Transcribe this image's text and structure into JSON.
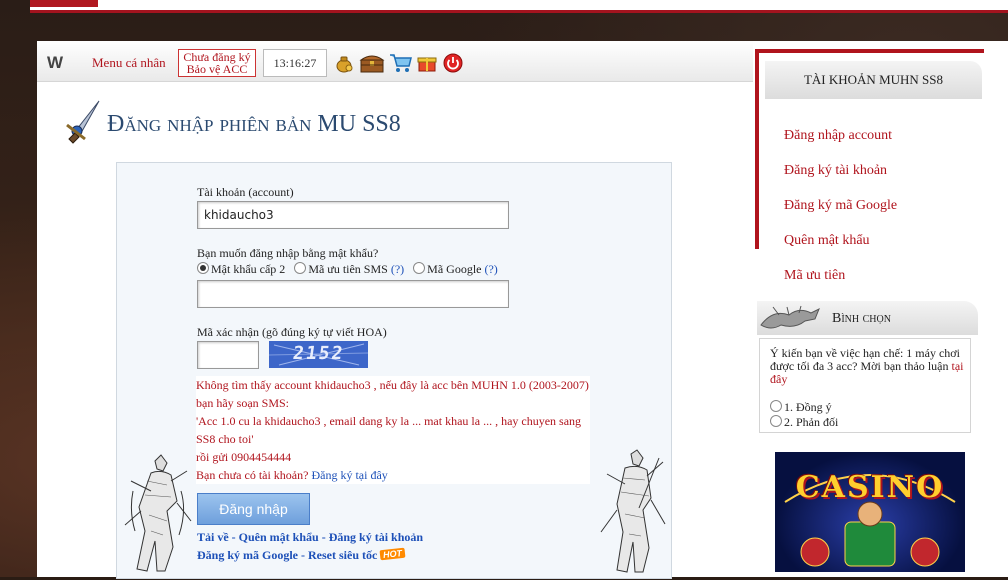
{
  "toolbar": {
    "menu_label": "Menu cá nhân",
    "register_line1": "Chưa đăng ký",
    "register_line2": "Bảo vệ ACC",
    "clock": "13:16:27"
  },
  "page": {
    "title": "Đăng nhập phiên bản MU SS8"
  },
  "login": {
    "account_label": "Tài khoản (account)",
    "account_value": "khidaucho3",
    "method_question": "Bạn muốn đăng nhập bằng mật khẩu?",
    "options": [
      {
        "label": "Mật khẩu cấp 2",
        "help": ""
      },
      {
        "label": "Mã ưu tiên SMS",
        "help": "(?)"
      },
      {
        "label": "Mã Google",
        "help": "(?)"
      }
    ],
    "password_value": "",
    "captcha_label": "Mã xác nhận (gõ đúng ký tự viết HOA)",
    "captcha_value": "",
    "captcha_text": "2152",
    "messages": [
      "Không tìm thấy account khidaucho3 , nếu đây là acc bên MUHN 1.0 (2003-2007)",
      "bạn hãy soạn SMS:",
      "'Acc 1.0 cu la khidaucho3 , email dang ky la ... mat khau la ... , hay chuyen sang SS8 cho toi'",
      "rồi gửi 0904454444",
      "Bạn chưa có tài khoản?"
    ],
    "register_here": "Đăng ký tại đây",
    "submit_label": "Đăng nhập",
    "links1": [
      "Tải về",
      "Quên mật khẩu",
      "Đăng ký tài khoản"
    ],
    "links2": [
      "Đăng ký mã Google",
      "Reset siêu tốc"
    ],
    "link_sep": " - ",
    "hot_badge": "HOT"
  },
  "sidebar": {
    "account_title": "TÀI KHOẢN MUHN SS8",
    "items": [
      {
        "label": "Đăng nhập account"
      },
      {
        "label": "Đăng ký tài khoản"
      },
      {
        "label": "Đăng ký mã Google"
      },
      {
        "label": "Quên mật khẩu"
      },
      {
        "label": "Mã ưu tiên"
      }
    ],
    "vote_title": "Bình chọn",
    "vote_question": "Ý kiến bạn về việc hạn chế: 1 máy chơi được tối đa 3 acc? Mời bạn thảo",
    "vote_question_tail": "luận",
    "vote_link": "tại đây",
    "vote_options": [
      "1. Đồng ý",
      "2. Phản đối"
    ],
    "banner_text": "CASINO"
  },
  "colors": {
    "accent_red": "#b0141d",
    "link_blue": "#1d50b8",
    "title_blue": "#2b4a70",
    "captcha_bg": "#3d66c9"
  },
  "icons": [
    "w-logo-icon",
    "money-bag-icon",
    "treasure-chest-icon",
    "shopping-cart-icon",
    "gift-icon",
    "power-icon",
    "sword-title-icon",
    "dragon-icon"
  ]
}
